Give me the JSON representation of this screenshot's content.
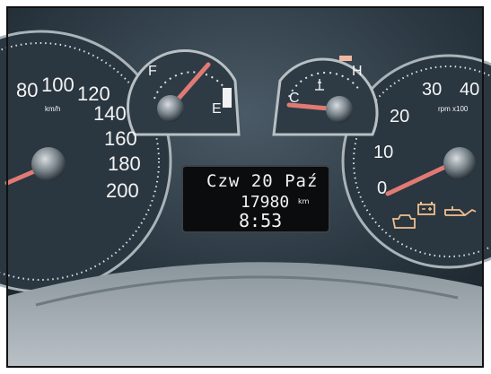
{
  "speedometer": {
    "unit": "km/h",
    "ticks": [
      "80",
      "100",
      "120",
      "140",
      "160",
      "180",
      "200"
    ],
    "reading": "0 km/h"
  },
  "fuel_gauge": {
    "full_label": "F",
    "empty_label": "E",
    "level": 0.75
  },
  "temperature_gauge": {
    "cold_label": "C",
    "hot_label": "H",
    "level": 0.05
  },
  "tachometer": {
    "unit": "rpm x100",
    "ticks": [
      "0",
      "10",
      "20",
      "30",
      "40"
    ],
    "reading": 0
  },
  "display": {
    "date": "Czw 20 Paź",
    "odometer": "17980",
    "odometer_unit": "km",
    "time": "8:53"
  },
  "warning_lights": [
    "battery-icon",
    "oil-pressure-icon",
    "engine-check-icon"
  ],
  "colors": {
    "needle": "#e07a74",
    "lcd_text": "#f2f2f2",
    "panel": "#2c3a44",
    "warning_amber": "#f0c090"
  }
}
